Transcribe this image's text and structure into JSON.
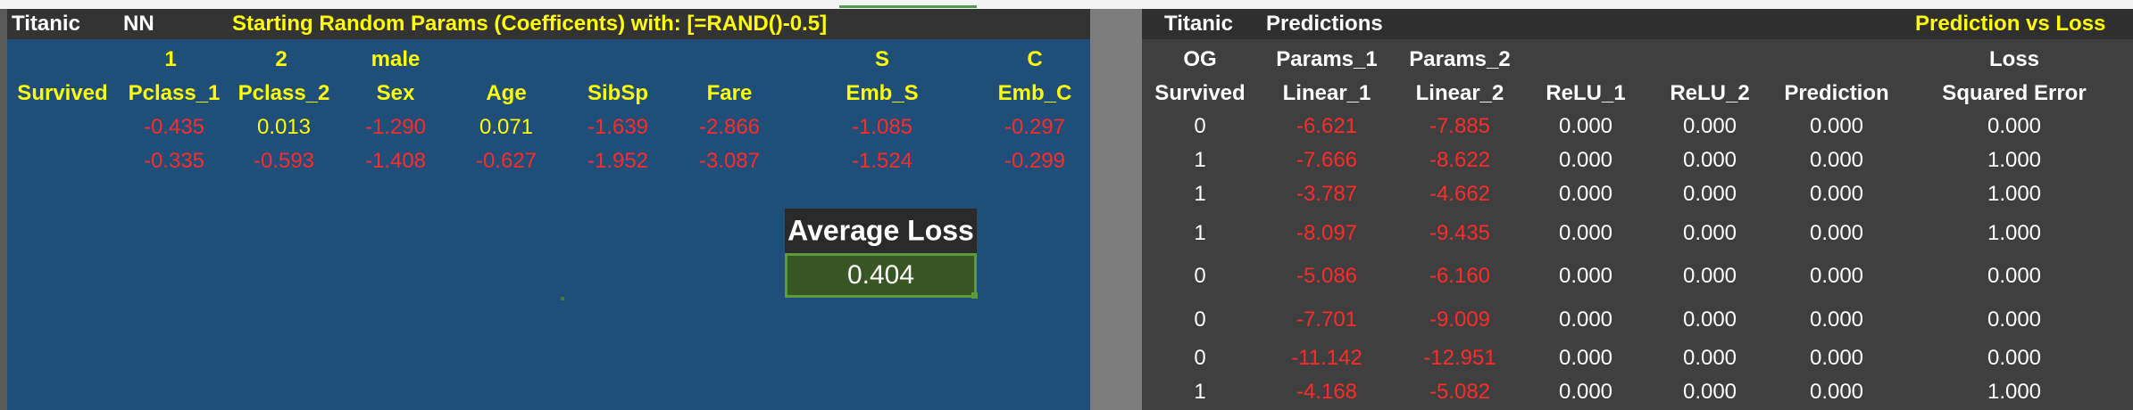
{
  "colors": {
    "yellow": "#ffff00",
    "red": "#ff2a2a",
    "white": "#ffffff",
    "left_bg": "#1f4e79",
    "right_bg": "#3f3f3f",
    "loss_bg": "#375623"
  },
  "left": {
    "header": {
      "titanic": "Titanic",
      "nn": "NN",
      "title": "Starting Random Params (Coefficents) with: [=RAND()-0.5]"
    },
    "row1_labels": [
      "1",
      "2",
      "male",
      "S",
      "C"
    ],
    "row2_labels": [
      "Survived",
      "Pclass_1",
      "Pclass_2",
      "Sex",
      "Age",
      "SibSp",
      "Fare",
      "Emb_S",
      "Emb_C"
    ],
    "params1": [
      "-0.435",
      "0.013",
      "-1.290",
      "0.071",
      "-1.639",
      "-2.866",
      "-1.085",
      "-0.297"
    ],
    "params2": [
      "-0.335",
      "-0.593",
      "-1.408",
      "-0.627",
      "-1.952",
      "-3.087",
      "-1.524",
      "-0.299"
    ],
    "average_loss": {
      "label": "Average Loss",
      "value": "0.404"
    }
  },
  "right": {
    "header": {
      "titanic": "Titanic",
      "predictions": "Predictions",
      "pred_vs_loss": "Prediction vs Loss"
    },
    "row1_labels": [
      "OG",
      "Params_1",
      "Params_2",
      "Loss"
    ],
    "row2_labels": [
      "Survived",
      "Linear_1",
      "Linear_2",
      "ReLU_1",
      "ReLU_2",
      "Prediction",
      "Squared Error"
    ],
    "rows": [
      [
        "0",
        "-6.621",
        "-7.885",
        "0.000",
        "0.000",
        "0.000",
        "0.000"
      ],
      [
        "1",
        "-7.666",
        "-8.622",
        "0.000",
        "0.000",
        "0.000",
        "1.000"
      ],
      [
        "1",
        "-3.787",
        "-4.662",
        "0.000",
        "0.000",
        "0.000",
        "1.000"
      ],
      [
        "1",
        "-8.097",
        "-9.435",
        "0.000",
        "0.000",
        "0.000",
        "1.000"
      ],
      [
        "0",
        "-5.086",
        "-6.160",
        "0.000",
        "0.000",
        "0.000",
        "0.000"
      ],
      [
        "0",
        "-7.701",
        "-9.009",
        "0.000",
        "0.000",
        "0.000",
        "0.000"
      ],
      [
        "0",
        "-11.142",
        "-12.951",
        "0.000",
        "0.000",
        "0.000",
        "0.000"
      ],
      [
        "1",
        "-4.168",
        "-5.082",
        "0.000",
        "0.000",
        "0.000",
        "1.000"
      ]
    ]
  }
}
